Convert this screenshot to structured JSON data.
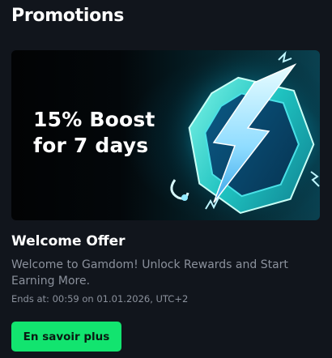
{
  "section": {
    "title": "Promotions"
  },
  "promotion": {
    "banner_line1": "15% Boost",
    "banner_line2": "for 7 days",
    "banner_art_icon": "lightning-shield-icon",
    "title": "Welcome Offer",
    "description": "Welcome to Gamdom! Unlock Rewards and Start Earning More.",
    "ends_at": "Ends at: 00:59 on 01.01.2026, UTC+2",
    "cta_label": "En savoir plus"
  },
  "colors": {
    "background": "#11151c",
    "cta_green": "#12e46f",
    "muted_text": "#8b919c",
    "accent_cyan": "#2ad8f0"
  }
}
